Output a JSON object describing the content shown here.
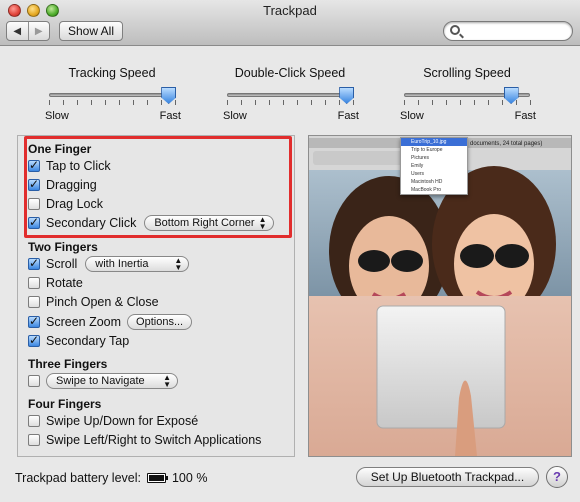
{
  "window": {
    "title": "Trackpad",
    "show_all_label": "Show All",
    "back_glyph": "◀",
    "forward_glyph": "▶",
    "search_placeholder": ""
  },
  "sliders": [
    {
      "title": "Tracking Speed",
      "min_label": "Slow",
      "max_label": "Fast",
      "value": 0.95
    },
    {
      "title": "Double-Click Speed",
      "min_label": "Slow",
      "max_label": "Fast",
      "value": 0.95
    },
    {
      "title": "Scrolling Speed",
      "min_label": "Slow",
      "max_label": "Fast",
      "value": 0.85
    }
  ],
  "one_finger": {
    "title": "One Finger",
    "tap_to_click": {
      "label": "Tap to Click",
      "checked": true
    },
    "dragging": {
      "label": "Dragging",
      "checked": true
    },
    "drag_lock": {
      "label": "Drag Lock",
      "checked": false
    },
    "secondary_click": {
      "label": "Secondary Click",
      "checked": true,
      "option": "Bottom Right Corner"
    }
  },
  "two_fingers": {
    "title": "Two Fingers",
    "scroll": {
      "label": "Scroll",
      "checked": true,
      "option": "with Inertia"
    },
    "rotate": {
      "label": "Rotate",
      "checked": false
    },
    "pinch": {
      "label": "Pinch Open & Close",
      "checked": false
    },
    "screen_zoom": {
      "label": "Screen Zoom",
      "checked": true,
      "button": "Options..."
    },
    "secondary_tap": {
      "label": "Secondary Tap",
      "checked": true
    }
  },
  "three_fingers": {
    "title": "Three Fingers",
    "swipe": {
      "checked": false,
      "option": "Swipe to Navigate"
    }
  },
  "four_fingers": {
    "title": "Four Fingers",
    "expose": {
      "label": "Swipe Up/Down for Exposé",
      "checked": false
    },
    "switch_apps": {
      "label": "Swipe Left/Right to Switch Applications",
      "checked": false
    }
  },
  "preview": {
    "caption": "documents, 24 total pages)",
    "menu_items": [
      "EuroTrip_10.jpg",
      "Trip to Europe",
      "Pictures",
      "Emily",
      "Users",
      "Macintosh HD",
      "MacBook Pro"
    ]
  },
  "footer": {
    "battery_label": "Trackpad battery level:",
    "battery_value": "100 %",
    "battery_level": 1.0,
    "setup_button": "Set Up Bluetooth Trackpad...",
    "help_glyph": "?"
  },
  "colors": {
    "accent": "#3b86e0",
    "highlight_box": "#e12d2d"
  }
}
